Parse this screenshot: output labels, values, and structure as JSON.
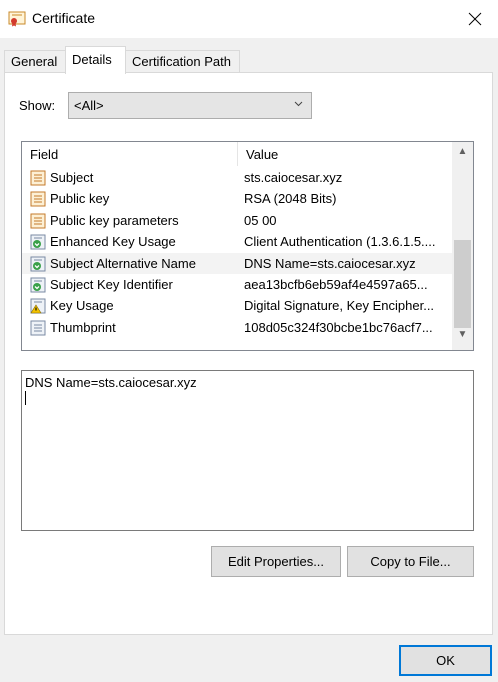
{
  "window": {
    "title": "Certificate",
    "close_icon": "close-icon"
  },
  "tabs": [
    {
      "label": "General",
      "active": false
    },
    {
      "label": "Details",
      "active": true
    },
    {
      "label": "Certification Path",
      "active": false
    }
  ],
  "show": {
    "label": "Show:",
    "selected": "<All>"
  },
  "list": {
    "columns": {
      "field": "Field",
      "value": "Value"
    },
    "rows": [
      {
        "icon": "certificate-field-icon",
        "field": "Subject",
        "value": "sts.caiocesar.xyz"
      },
      {
        "icon": "certificate-field-icon",
        "field": "Public key",
        "value": "RSA (2048 Bits)"
      },
      {
        "icon": "certificate-field-icon",
        "field": "Public key parameters",
        "value": "05 00"
      },
      {
        "icon": "extension-icon",
        "field": "Enhanced Key Usage",
        "value": "Client Authentication (1.3.6.1.5...."
      },
      {
        "icon": "extension-icon",
        "field": "Subject Alternative Name",
        "value": "DNS Name=sts.caiocesar.xyz",
        "selected": true
      },
      {
        "icon": "extension-icon",
        "field": "Subject Key Identifier",
        "value": "aea13bcfb6eb59af4e4597a65..."
      },
      {
        "icon": "critical-extension-icon",
        "field": "Key Usage",
        "value": "Digital Signature, Key Encipher..."
      },
      {
        "icon": "property-icon",
        "field": "Thumbprint",
        "value": "108d05c324f30bcbe1bc76acf7..."
      }
    ]
  },
  "detail": {
    "text": "DNS Name=sts.caiocesar.xyz"
  },
  "buttons": {
    "edit_properties": "Edit Properties...",
    "copy_to_file": "Copy to File...",
    "ok": "OK"
  }
}
